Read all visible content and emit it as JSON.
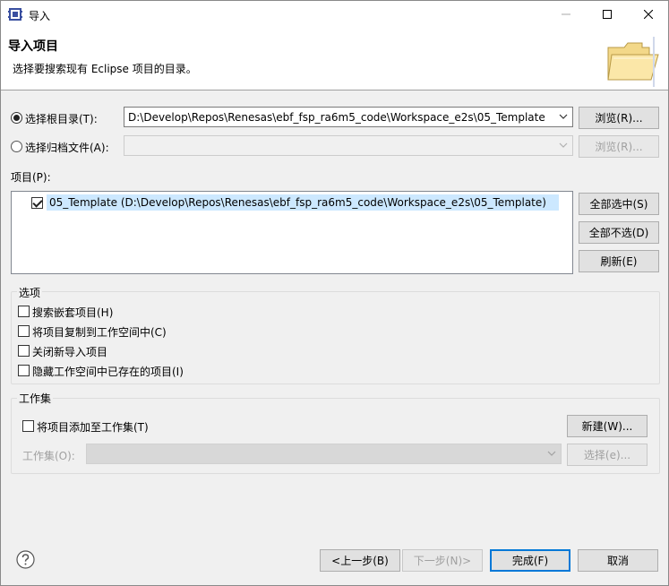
{
  "window": {
    "title": "导入"
  },
  "banner": {
    "title": "导入项目",
    "description": "选择要搜索现有 Eclipse 项目的目录。"
  },
  "root_dir": {
    "label": "选择根目录(T):",
    "value": "D:\\Develop\\Repos\\Renesas\\ebf_fsp_ra6m5_code\\Workspace_e2s\\05_Template",
    "browse": "浏览(R)...",
    "selected": true
  },
  "archive": {
    "label": "选择归档文件(A):",
    "value": "",
    "browse": "浏览(R)...",
    "selected": false
  },
  "projects": {
    "label": "项目(P):",
    "items": [
      {
        "text": "05_Template  (D:\\Develop\\Repos\\Renesas\\ebf_fsp_ra6m5_code\\Workspace_e2s\\05_Template)",
        "checked": true
      }
    ],
    "select_all": "全部选中(S)",
    "deselect_all": "全部不选(D)",
    "refresh": "刷新(E)"
  },
  "options": {
    "title": "选项",
    "items": [
      {
        "label": "搜索嵌套项目(H)",
        "checked": false
      },
      {
        "label": "将项目复制到工作空间中(C)",
        "checked": false
      },
      {
        "label": "关闭新导入项目",
        "checked": false
      },
      {
        "label": "隐藏工作空间中已存在的项目(I)",
        "checked": false
      }
    ]
  },
  "working_sets": {
    "title": "工作集",
    "add_label": "将项目添加至工作集(T)",
    "new_button": "新建(W)...",
    "sets_label": "工作集(O):",
    "sets_value": "",
    "select_button": "选择(e)..."
  },
  "footer": {
    "back": "<上一步(B)",
    "next": "下一步(N)>",
    "finish": "完成(F)",
    "cancel": "取消"
  },
  "colors": {
    "accent": "#0078d7",
    "selection": "#cce8ff"
  }
}
